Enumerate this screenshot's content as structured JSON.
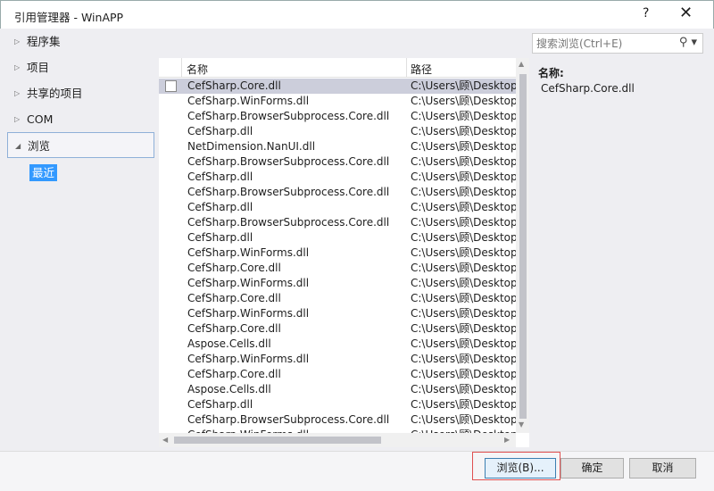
{
  "window": {
    "title": "引用管理器 - WinAPP",
    "help": "?",
    "close": "✕"
  },
  "nav": {
    "items": [
      {
        "label": "程序集",
        "expanded": false
      },
      {
        "label": "项目",
        "expanded": false
      },
      {
        "label": "共享的项目",
        "expanded": false
      },
      {
        "label": "COM",
        "expanded": false
      },
      {
        "label": "浏览",
        "expanded": true
      }
    ],
    "sub_item": "最近"
  },
  "search": {
    "placeholder": "搜索浏览(Ctrl+E)",
    "icon": "search-icon"
  },
  "list": {
    "columns": [
      "名称",
      "路径"
    ],
    "rows": [
      {
        "name": "CefSharp.Core.dll",
        "path": "C:\\Users\\顾\\Desktop"
      },
      {
        "name": "CefSharp.WinForms.dll",
        "path": "C:\\Users\\顾\\Desktop"
      },
      {
        "name": "CefSharp.BrowserSubprocess.Core.dll",
        "path": "C:\\Users\\顾\\Desktop"
      },
      {
        "name": "CefSharp.dll",
        "path": "C:\\Users\\顾\\Desktop"
      },
      {
        "name": "NetDimension.NanUI.dll",
        "path": "C:\\Users\\顾\\Desktop"
      },
      {
        "name": "CefSharp.BrowserSubprocess.Core.dll",
        "path": "C:\\Users\\顾\\Desktop"
      },
      {
        "name": "CefSharp.dll",
        "path": "C:\\Users\\顾\\Desktop"
      },
      {
        "name": "CefSharp.BrowserSubprocess.Core.dll",
        "path": "C:\\Users\\顾\\Desktop"
      },
      {
        "name": "CefSharp.dll",
        "path": "C:\\Users\\顾\\Desktop"
      },
      {
        "name": "CefSharp.BrowserSubprocess.Core.dll",
        "path": "C:\\Users\\顾\\Desktop"
      },
      {
        "name": "CefSharp.dll",
        "path": "C:\\Users\\顾\\Desktop"
      },
      {
        "name": "CefSharp.WinForms.dll",
        "path": "C:\\Users\\顾\\Desktop"
      },
      {
        "name": "CefSharp.Core.dll",
        "path": "C:\\Users\\顾\\Desktop"
      },
      {
        "name": "CefSharp.WinForms.dll",
        "path": "C:\\Users\\顾\\Desktop"
      },
      {
        "name": "CefSharp.Core.dll",
        "path": "C:\\Users\\顾\\Desktop"
      },
      {
        "name": "CefSharp.WinForms.dll",
        "path": "C:\\Users\\顾\\Desktop"
      },
      {
        "name": "CefSharp.Core.dll",
        "path": "C:\\Users\\顾\\Desktop"
      },
      {
        "name": "Aspose.Cells.dll",
        "path": "C:\\Users\\顾\\Desktop"
      },
      {
        "name": "CefSharp.WinForms.dll",
        "path": "C:\\Users\\顾\\Desktop"
      },
      {
        "name": "CefSharp.Core.dll",
        "path": "C:\\Users\\顾\\Desktop"
      },
      {
        "name": "Aspose.Cells.dll",
        "path": "C:\\Users\\顾\\Desktop"
      },
      {
        "name": "CefSharp.dll",
        "path": "C:\\Users\\顾\\Desktop"
      },
      {
        "name": "CefSharp.BrowserSubprocess.Core.dll",
        "path": "C:\\Users\\顾\\Desktop"
      },
      {
        "name": "CefSharp.WinForms.dll",
        "path": "C:\\Users\\顾\\Desktop"
      }
    ],
    "selected_index": 0
  },
  "detail": {
    "label": "名称:",
    "value": "CefSharp.Core.dll"
  },
  "buttons": {
    "browse": "浏览(B)...",
    "ok": "确定",
    "cancel": "取消"
  },
  "colors": {
    "accent": "#3399ff",
    "selected_row": "#cccedb",
    "highlight_box": "#e05050"
  }
}
